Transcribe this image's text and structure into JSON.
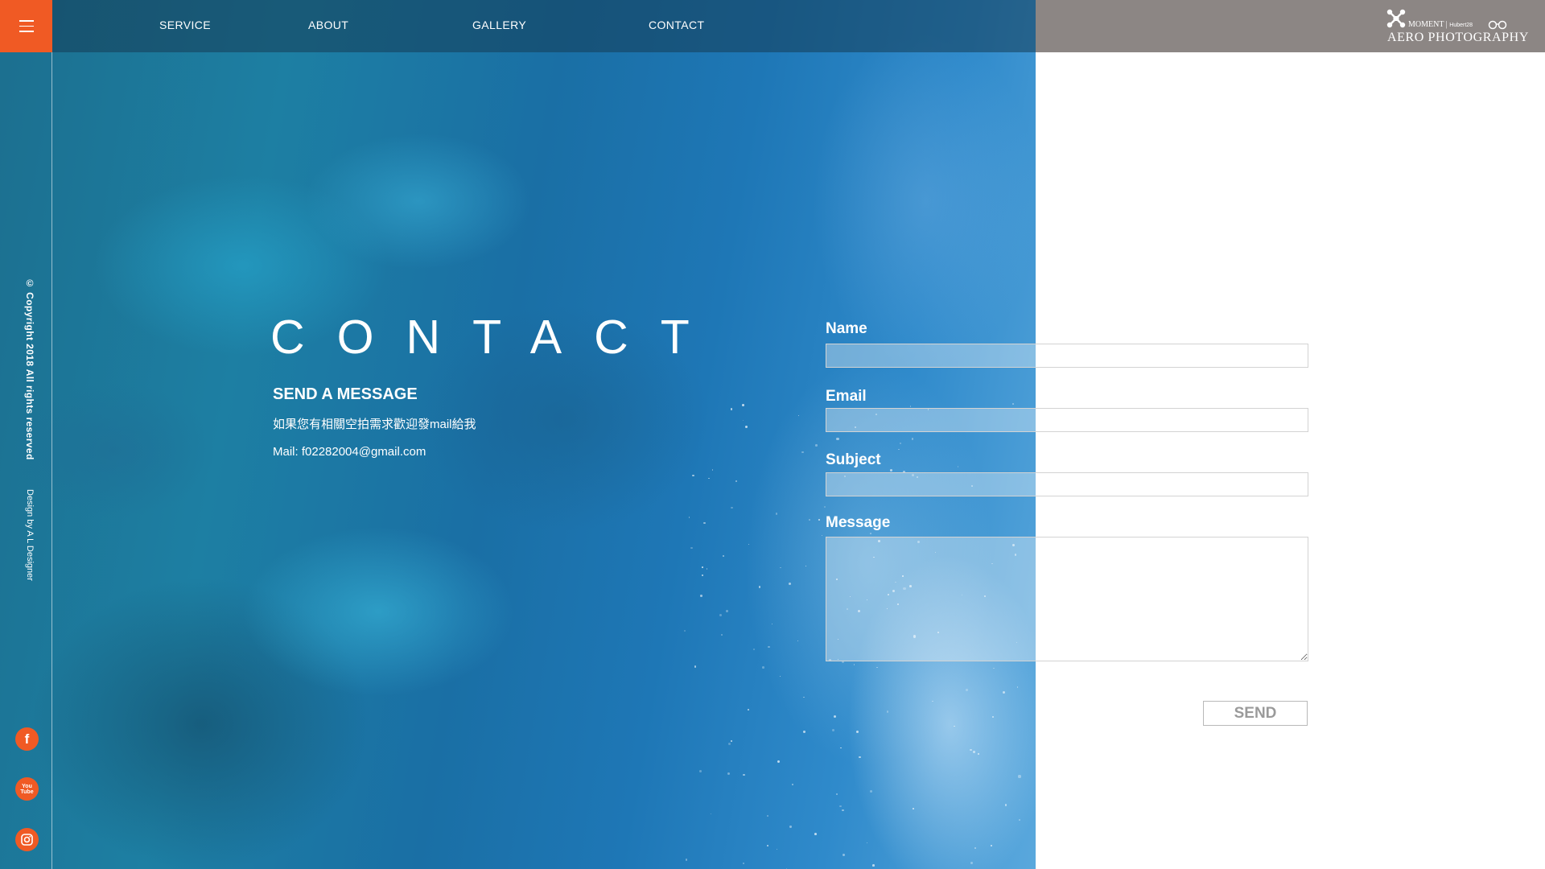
{
  "brand": {
    "moment": "MOMENT",
    "partner": "Hubert28",
    "name": "AERO PHOTOGRAPHY",
    "accent_color": "#f05a24"
  },
  "nav": {
    "menu_icon": "hamburger-icon",
    "items": [
      {
        "label": "SERVICE"
      },
      {
        "label": "ABOUT"
      },
      {
        "label": "GALLERY"
      },
      {
        "label": "CONTACT"
      }
    ]
  },
  "sidebar": {
    "copyright": "© Copyright 2018 All rights reserved",
    "design_credit": "Design by A L Designer",
    "social": [
      {
        "icon": "facebook-icon",
        "glyph": "f"
      },
      {
        "icon": "youtube-icon",
        "glyph": "You\nTube"
      },
      {
        "icon": "instagram-icon"
      }
    ]
  },
  "contact": {
    "title": "CONTACT",
    "subtitle": "SEND A MESSAGE",
    "description": "如果您有相關空拍需求歡迎發mail給我",
    "mail_line": "Mail: f02282004@gmail.com"
  },
  "form": {
    "name_label": "Name",
    "name_value": "",
    "email_label": "Email",
    "email_value": "",
    "subject_label": "Subject",
    "subject_value": "",
    "message_label": "Message",
    "message_value": "",
    "send_label": "SEND"
  }
}
